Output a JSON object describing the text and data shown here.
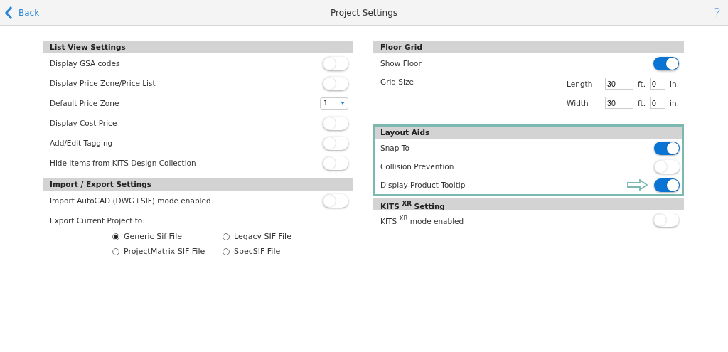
{
  "header": {
    "back": "Back",
    "title": "Project Settings",
    "help": "?"
  },
  "columns": [
    [
      {
        "title": "List View Settings",
        "highlighted": false,
        "rows": [
          {
            "kind": "toggle",
            "label": "Display GSA codes",
            "on": false
          },
          {
            "kind": "toggle",
            "label": "Display Price Zone/Price List",
            "on": false
          },
          {
            "kind": "select",
            "label": "Default Price Zone",
            "value": "1"
          },
          {
            "kind": "toggle",
            "label": "Display Cost Price",
            "on": false
          },
          {
            "kind": "toggle",
            "label": "Add/Edit Tagging",
            "on": false
          },
          {
            "kind": "toggle",
            "label": "Hide Items from KITS Design Collection",
            "on": false
          }
        ]
      },
      {
        "title": "Import / Export Settings",
        "highlighted": false,
        "rows": [
          {
            "kind": "toggle",
            "label": "Import AutoCAD (DWG+SIF) mode enabled",
            "on": false
          },
          {
            "kind": "radio_group",
            "label": "Export Current Project to:",
            "options": [
              {
                "label": "Generic Sif File",
                "selected": true
              },
              {
                "label": "Legacy SIF File",
                "selected": false
              },
              {
                "label": "ProjectMatrix SIF File",
                "selected": false
              },
              {
                "label": "SpecSIF File",
                "selected": false
              }
            ]
          }
        ]
      }
    ],
    [
      {
        "title": "Floor Grid",
        "highlighted": false,
        "rows": [
          {
            "kind": "toggle",
            "label": "Show Floor",
            "on": true
          },
          {
            "kind": "grid",
            "label": "Grid Size",
            "fields": [
              {
                "label": "Length",
                "feet": "30",
                "feet_unit": "ft.",
                "inches": "0",
                "inches_unit": "in."
              },
              {
                "label": "Width",
                "feet": "30",
                "feet_unit": "ft.",
                "inches": "0",
                "inches_unit": "in."
              }
            ]
          }
        ]
      },
      {
        "title": "Layout Aids",
        "highlighted": true,
        "rows": [
          {
            "kind": "toggle",
            "label": "Snap To",
            "on": true
          },
          {
            "kind": "toggle",
            "label": "Collision Prevention",
            "on": false
          },
          {
            "kind": "toggle",
            "label": "Display Product Tooltip",
            "on": true,
            "arrow": true
          }
        ]
      },
      {
        "title": "KITS $^{XR}$ Setting",
        "highlighted": false,
        "rows": [
          {
            "kind": "toggle",
            "label": "KITS $^{XR}$ mode enabled",
            "on": false
          }
        ]
      }
    ]
  ]
}
